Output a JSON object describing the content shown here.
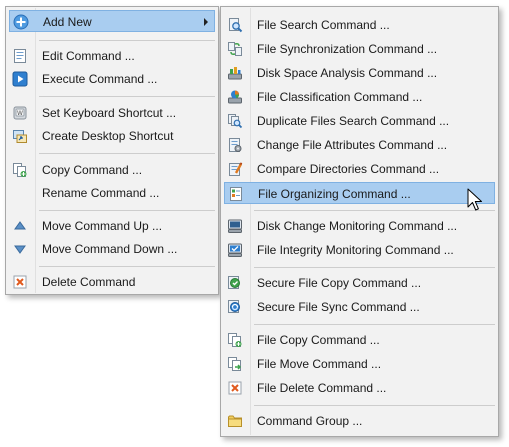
{
  "colors": {
    "menu_background": "#f2f2f2",
    "menu_border": "#a8a8a8",
    "highlight_fill": "#a9cdf0",
    "highlight_border": "#7fb1e2"
  },
  "main_menu": {
    "items": [
      {
        "label": "Add New",
        "icon": "add-new-icon"
      },
      {
        "label": "Edit Command ...",
        "icon": "edit-icon"
      },
      {
        "label": "Execute Command ...",
        "icon": "execute-icon"
      },
      {
        "label": "Set Keyboard Shortcut ...",
        "icon": "keyboard-icon"
      },
      {
        "label": "Create Desktop Shortcut",
        "icon": "shortcut-icon"
      },
      {
        "label": "Copy Command ...",
        "icon": "copy-icon"
      },
      {
        "label": "Rename Command ...",
        "icon": ""
      },
      {
        "label": "Move Command Up ...",
        "icon": "move-up-icon"
      },
      {
        "label": "Move Command Down ...",
        "icon": "move-down-icon"
      },
      {
        "label": "Delete Command",
        "icon": "delete-icon"
      }
    ]
  },
  "sub_menu": {
    "items": [
      {
        "label": "File Search Command ...",
        "icon": "file-search-icon"
      },
      {
        "label": "File Synchronization Command ...",
        "icon": "file-sync-icon"
      },
      {
        "label": "Disk Space Analysis Command ...",
        "icon": "disk-space-icon"
      },
      {
        "label": "File Classification Command ...",
        "icon": "file-classification-icon"
      },
      {
        "label": "Duplicate Files Search Command ...",
        "icon": "duplicate-search-icon"
      },
      {
        "label": "Change File Attributes Command ...",
        "icon": "file-attributes-icon"
      },
      {
        "label": "Compare Directories Command ...",
        "icon": "compare-directories-icon"
      },
      {
        "label": "File Organizing Command ...",
        "icon": "file-organizing-icon"
      },
      {
        "label": "Disk Change Monitoring Command ...",
        "icon": "disk-monitor-icon"
      },
      {
        "label": "File Integrity Monitoring Command ...",
        "icon": "integrity-monitor-icon"
      },
      {
        "label": "Secure File Copy Command ...",
        "icon": "secure-copy-icon"
      },
      {
        "label": "Secure File Sync Command ...",
        "icon": "secure-sync-icon"
      },
      {
        "label": "File Copy Command ...",
        "icon": "file-copy-icon"
      },
      {
        "label": "File Move Command ...",
        "icon": "file-move-icon"
      },
      {
        "label": "File Delete Command ...",
        "icon": "file-delete-icon"
      },
      {
        "label": "Command Group ...",
        "icon": "folder-icon"
      }
    ]
  }
}
